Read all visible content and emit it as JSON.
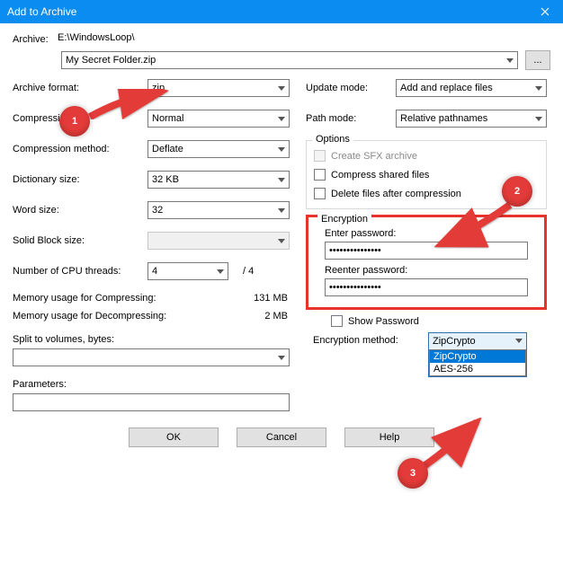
{
  "window": {
    "title": "Add to Archive",
    "close": "X"
  },
  "top": {
    "archive_label": "Archive:",
    "path": "E:\\WindowsLoop\\",
    "filename": "My Secret Folder.zip",
    "browse": "..."
  },
  "left": {
    "archive_format_label": "Archive format:",
    "archive_format_value": "zip",
    "compression_level_label": "Compressi",
    "compression_level_value": "Normal",
    "compression_method_label": "Compression method:",
    "compression_method_value": "Deflate",
    "dictionary_label": "Dictionary size:",
    "dictionary_value": "32 KB",
    "word_label": "Word size:",
    "word_value": "32",
    "solid_label": "Solid Block size:",
    "solid_value": "",
    "cpu_label": "Number of CPU threads:",
    "cpu_value": "4",
    "cpu_total": "/ 4",
    "mem_compress_label": "Memory usage for Compressing:",
    "mem_compress_value": "131 MB",
    "mem_decompress_label": "Memory usage for Decompressing:",
    "mem_decompress_value": "2 MB",
    "split_label": "Split to volumes, bytes:",
    "split_value": "",
    "parameters_label": "Parameters:",
    "parameters_value": ""
  },
  "right": {
    "update_label": "Update mode:",
    "update_value": "Add and replace files",
    "path_label": "Path mode:",
    "path_value": "Relative pathnames",
    "options_legend": "Options",
    "sfx_label": "Create SFX archive",
    "shared_label": "Compress shared files",
    "delete_label": "Delete files after compression",
    "encryption_legend": "Encryption",
    "enter_pw_label": "Enter password:",
    "enter_pw_value": "•••••••••••••••",
    "reenter_pw_label": "Reenter password:",
    "reenter_pw_value": "•••••••••••••••",
    "show_pw_label": "Show Password",
    "enc_method_label": "Encryption method:",
    "enc_method_selected": "ZipCrypto",
    "enc_method_options": [
      "ZipCrypto",
      "AES-256"
    ]
  },
  "footer": {
    "ok": "OK",
    "cancel": "Cancel",
    "help": "Help"
  },
  "annotations": {
    "n1": "1",
    "n2": "2",
    "n3": "3"
  }
}
